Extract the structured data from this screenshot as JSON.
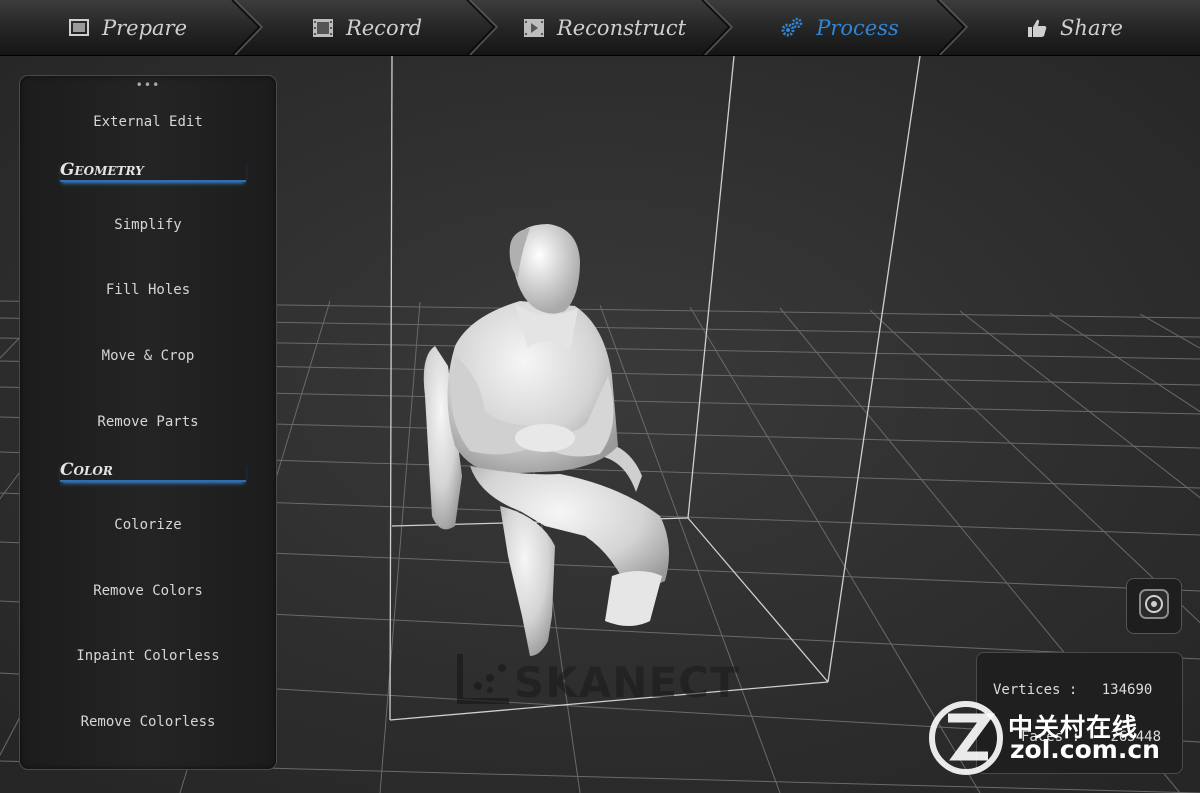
{
  "nav": {
    "tabs": [
      {
        "label": "Prepare",
        "icon": "photos-icon",
        "active": false
      },
      {
        "label": "Record",
        "icon": "film-icon",
        "active": false
      },
      {
        "label": "Reconstruct",
        "icon": "film-frame-icon",
        "active": false
      },
      {
        "label": "Process",
        "icon": "gears-icon",
        "active": true
      },
      {
        "label": "Share",
        "icon": "thumbs-up-icon",
        "active": false
      }
    ],
    "active_color": "#2f86d6"
  },
  "panel": {
    "handle": "•••",
    "external_edit": "External Edit",
    "geometry_title": "Geometry",
    "geometry_items": [
      "Simplify",
      "Fill Holes",
      "Move & Crop",
      "Remove Parts"
    ],
    "color_title": "Color",
    "color_items": [
      "Colorize",
      "Remove Colors",
      "Inpaint Colorless",
      "Remove Colorless"
    ]
  },
  "stats": {
    "vertices_label": "Vertices :",
    "vertices_value": "134690",
    "faces_label": "Faces :",
    "faces_value": "265448"
  },
  "brand": "SKANECT",
  "watermark": {
    "cn": "中关村在线",
    "url": "zol.com.cn"
  },
  "camera_button_icon": "camera-reset-icon"
}
